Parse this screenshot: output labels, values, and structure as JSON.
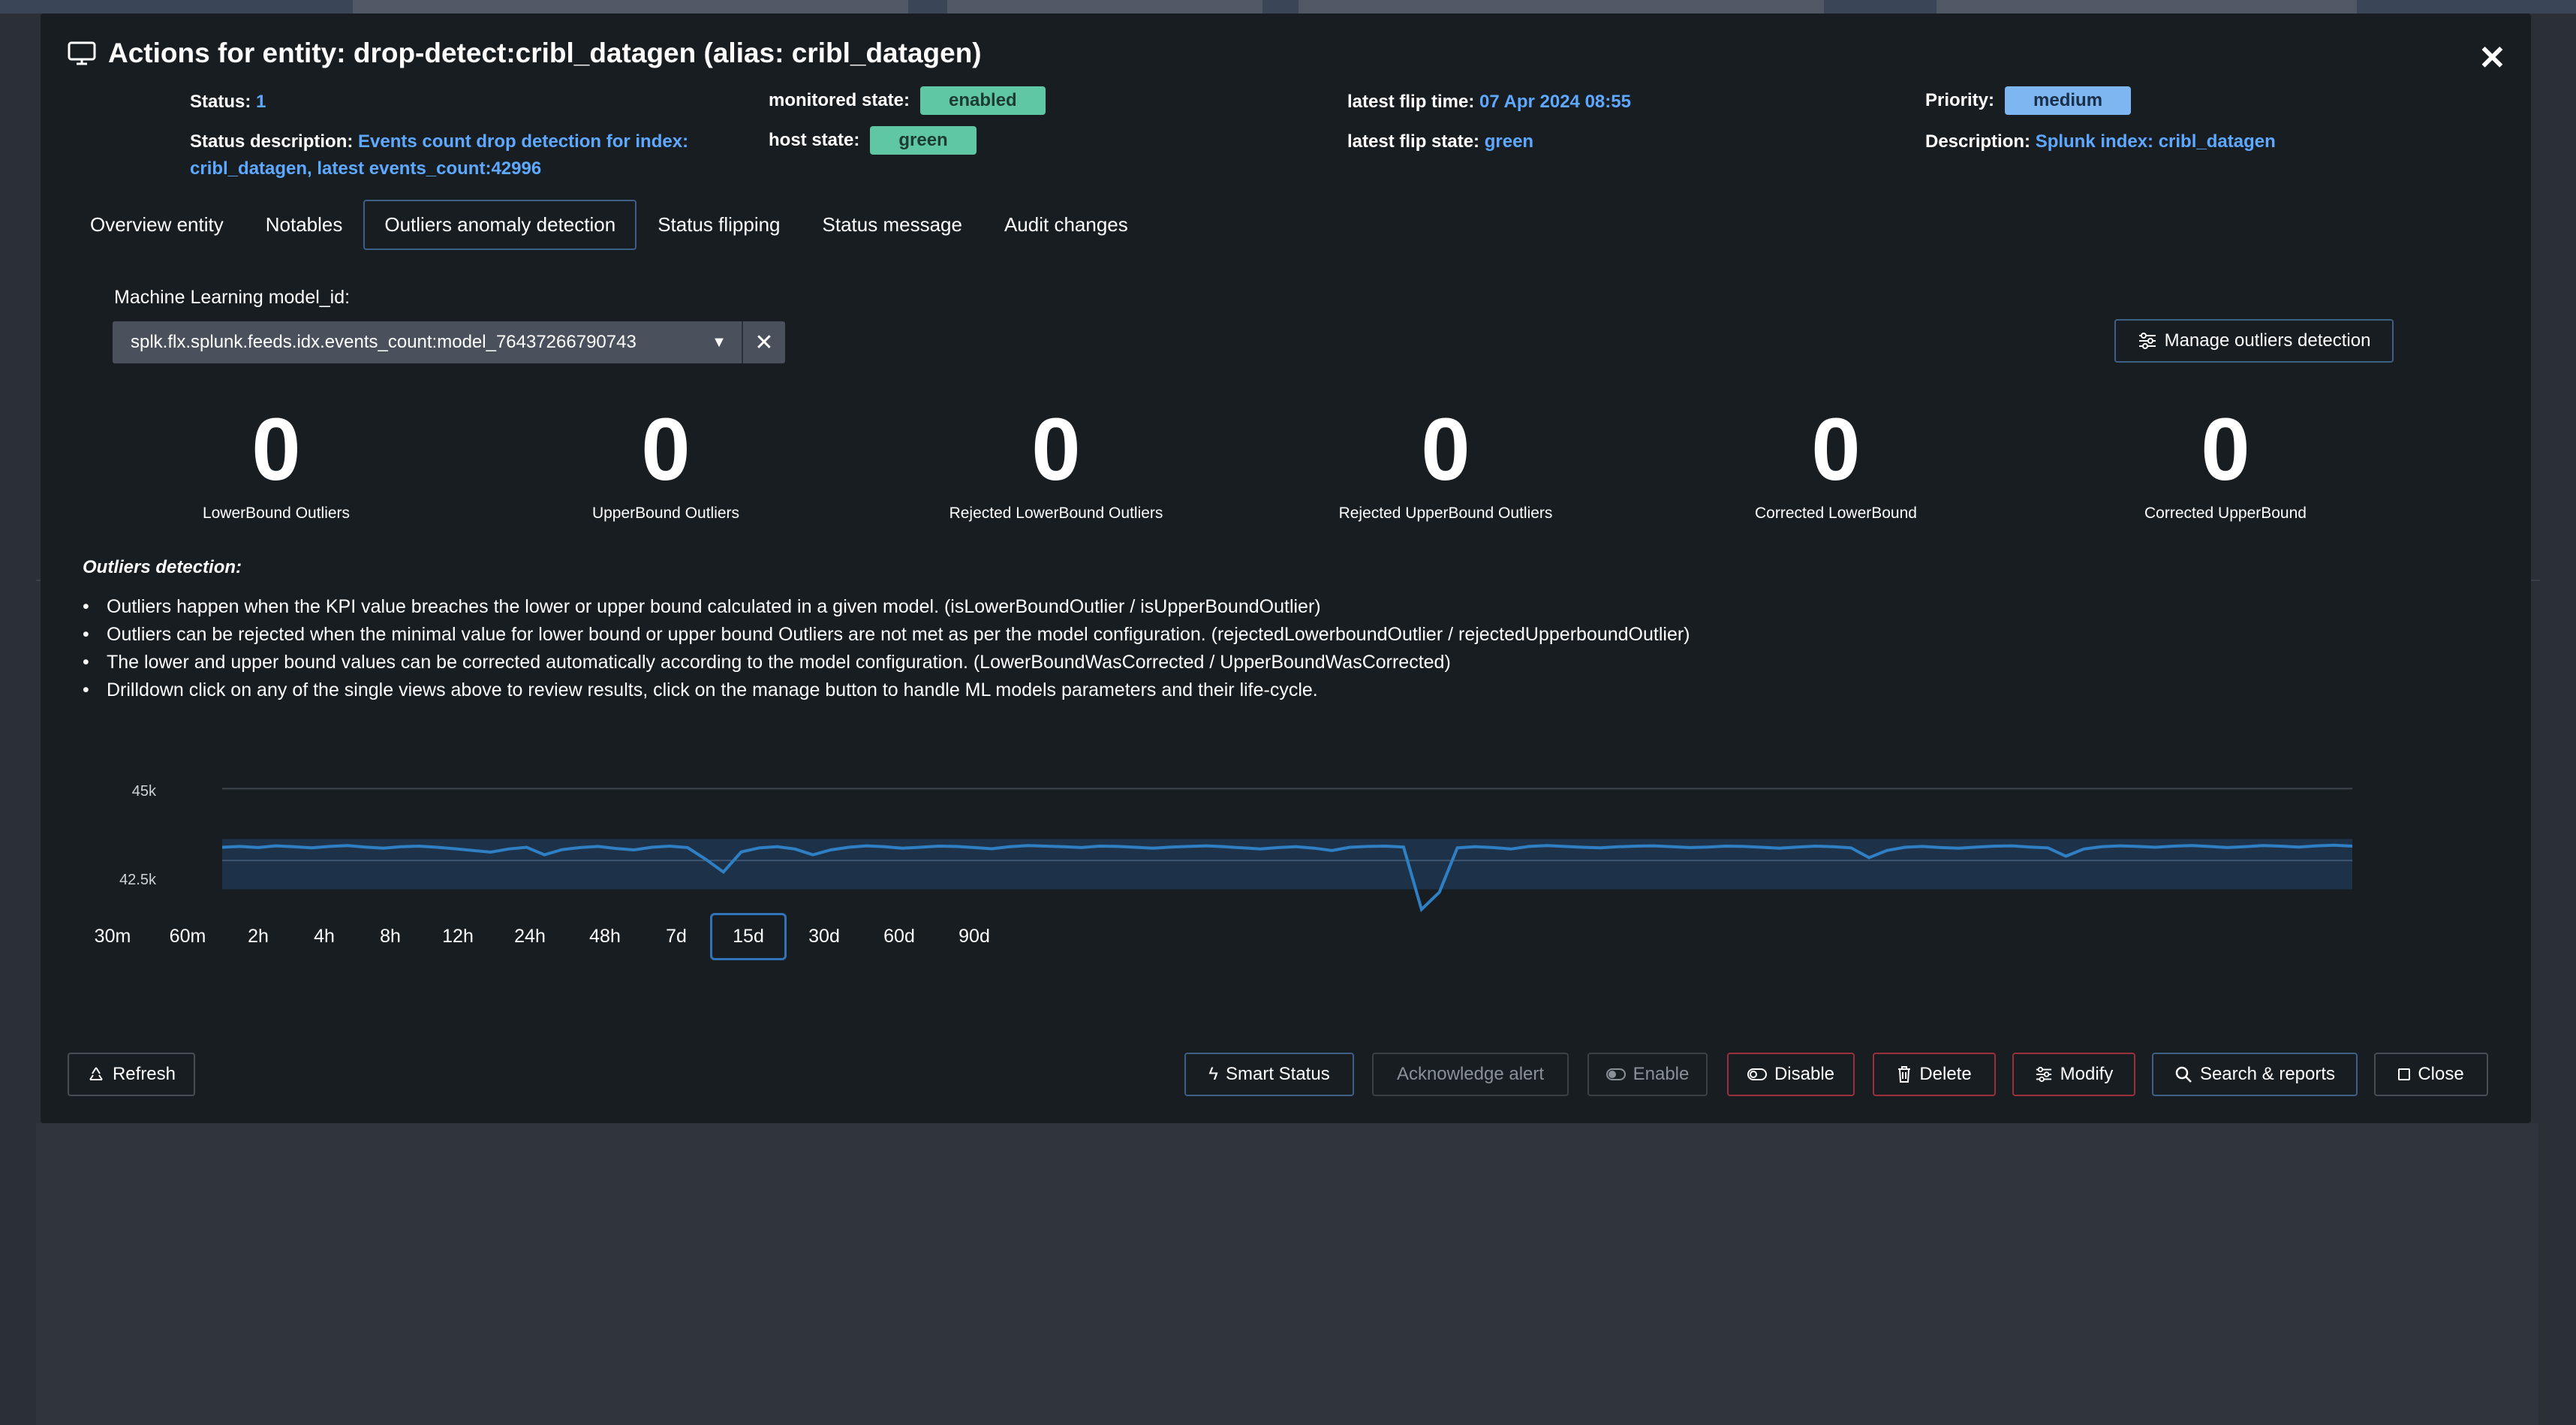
{
  "modal": {
    "title": "Actions for entity: drop-detect:cribl_datagen (alias: cribl_datagen)"
  },
  "status": {
    "status_label": "Status:",
    "status_value": "1",
    "status_desc_label": "Status description:",
    "status_desc_value_line1": "Events count drop detection for index:",
    "status_desc_value_line2": "cribl_datagen, latest events_count:42996",
    "monitored_label": "monitored state:",
    "monitored_value": "enabled",
    "host_label": "host state:",
    "host_value": "green",
    "flip_time_label": "latest flip time:",
    "flip_time_value": "07 Apr 2024 08:55",
    "flip_state_label": "latest flip state:",
    "flip_state_value": "green",
    "priority_label": "Priority:",
    "priority_value": "medium",
    "description_label": "Description:",
    "description_value": "Splunk index: cribl_datagen"
  },
  "tabs": [
    {
      "label": "Overview entity"
    },
    {
      "label": "Notables"
    },
    {
      "label": "Outliers anomaly detection",
      "active": true
    },
    {
      "label": "Status flipping"
    },
    {
      "label": "Status message"
    },
    {
      "label": "Audit changes"
    }
  ],
  "ml": {
    "label": "Machine Learning model_id:",
    "selected": "splk.flx.splunk.feeds.idx.events_count:model_76437266790743",
    "manage_label": "Manage outliers detection"
  },
  "stats": [
    {
      "value": "0",
      "label": "LowerBound Outliers"
    },
    {
      "value": "0",
      "label": "UpperBound Outliers"
    },
    {
      "value": "0",
      "label": "Rejected LowerBound Outliers"
    },
    {
      "value": "0",
      "label": "Rejected UpperBound Outliers"
    },
    {
      "value": "0",
      "label": "Corrected LowerBound"
    },
    {
      "value": "0",
      "label": "Corrected UpperBound"
    }
  ],
  "outliers_desc": {
    "heading": "Outliers detection:",
    "bullets": [
      "Outliers happen when the KPI value breaches the lower or upper bound calculated in a given model. (isLowerBoundOutlier / isUpperBoundOutlier)",
      "Outliers can be rejected when the minimal value for lower bound or upper bound Outliers are not met as per the model configuration. (rejectedLowerboundOutlier / rejectedUpperboundOutlier)",
      "The lower and upper bound values can be corrected automatically according to the model configuration. (LowerBoundWasCorrected / UpperBoundWasCorrected)",
      "Drilldown click on any of the single views above to review results, click on the manage button to handle ML models parameters and their life-cycle."
    ]
  },
  "chart_data": {
    "type": "area",
    "y_ticks": [
      "45k",
      "42.5k"
    ],
    "ylim": [
      40000,
      46000
    ],
    "band": [
      41500,
      43250
    ],
    "grid": true,
    "series_color": "#2f7fc4",
    "x_count": 120,
    "values": [
      42960,
      42990,
      42950,
      43010,
      42980,
      42940,
      42990,
      43020,
      42970,
      42930,
      42980,
      43000,
      42960,
      42910,
      42850,
      42790,
      42900,
      42960,
      42700,
      42880,
      42950,
      42990,
      42920,
      42870,
      42960,
      43000,
      42950,
      42550,
      42100,
      42800,
      42940,
      42980,
      42900,
      42700,
      42870,
      42960,
      43010,
      42980,
      42930,
      42960,
      43000,
      42990,
      42950,
      42910,
      42980,
      43020,
      43000,
      42980,
      42950,
      43000,
      42990,
      42960,
      42930,
      42970,
      42990,
      43010,
      42980,
      42940,
      42900,
      42950,
      42980,
      42930,
      42850,
      42960,
      42990,
      43000,
      42970,
      40800,
      41400,
      42940,
      42980,
      42950,
      42900,
      42990,
      43020,
      42990,
      42960,
      42940,
      42980,
      43000,
      43010,
      42980,
      42950,
      42970,
      43000,
      42990,
      42960,
      42930,
      42970,
      43000,
      42980,
      42940,
      42600,
      42850,
      42960,
      42990,
      42950,
      42930,
      42970,
      43000,
      43010,
      42970,
      42940,
      42650,
      42900,
      42980,
      43010,
      42990,
      42960,
      43000,
      43020,
      42990,
      42950,
      42980,
      43020,
      43000,
      42970,
      43010,
      43030,
      43000
    ],
    "range_buttons": [
      "30m",
      "60m",
      "2h",
      "4h",
      "8h",
      "12h",
      "24h",
      "48h",
      "7d",
      "15d",
      "30d",
      "60d",
      "90d"
    ],
    "range_selected": "15d"
  },
  "footer": {
    "refresh": "Refresh",
    "smart_status": "Smart Status",
    "acknowledge": "Acknowledge alert",
    "enable": "Enable",
    "disable": "Disable",
    "delete": "Delete",
    "modify": "Modify",
    "search_reports": "Search & reports",
    "close": "Close"
  }
}
